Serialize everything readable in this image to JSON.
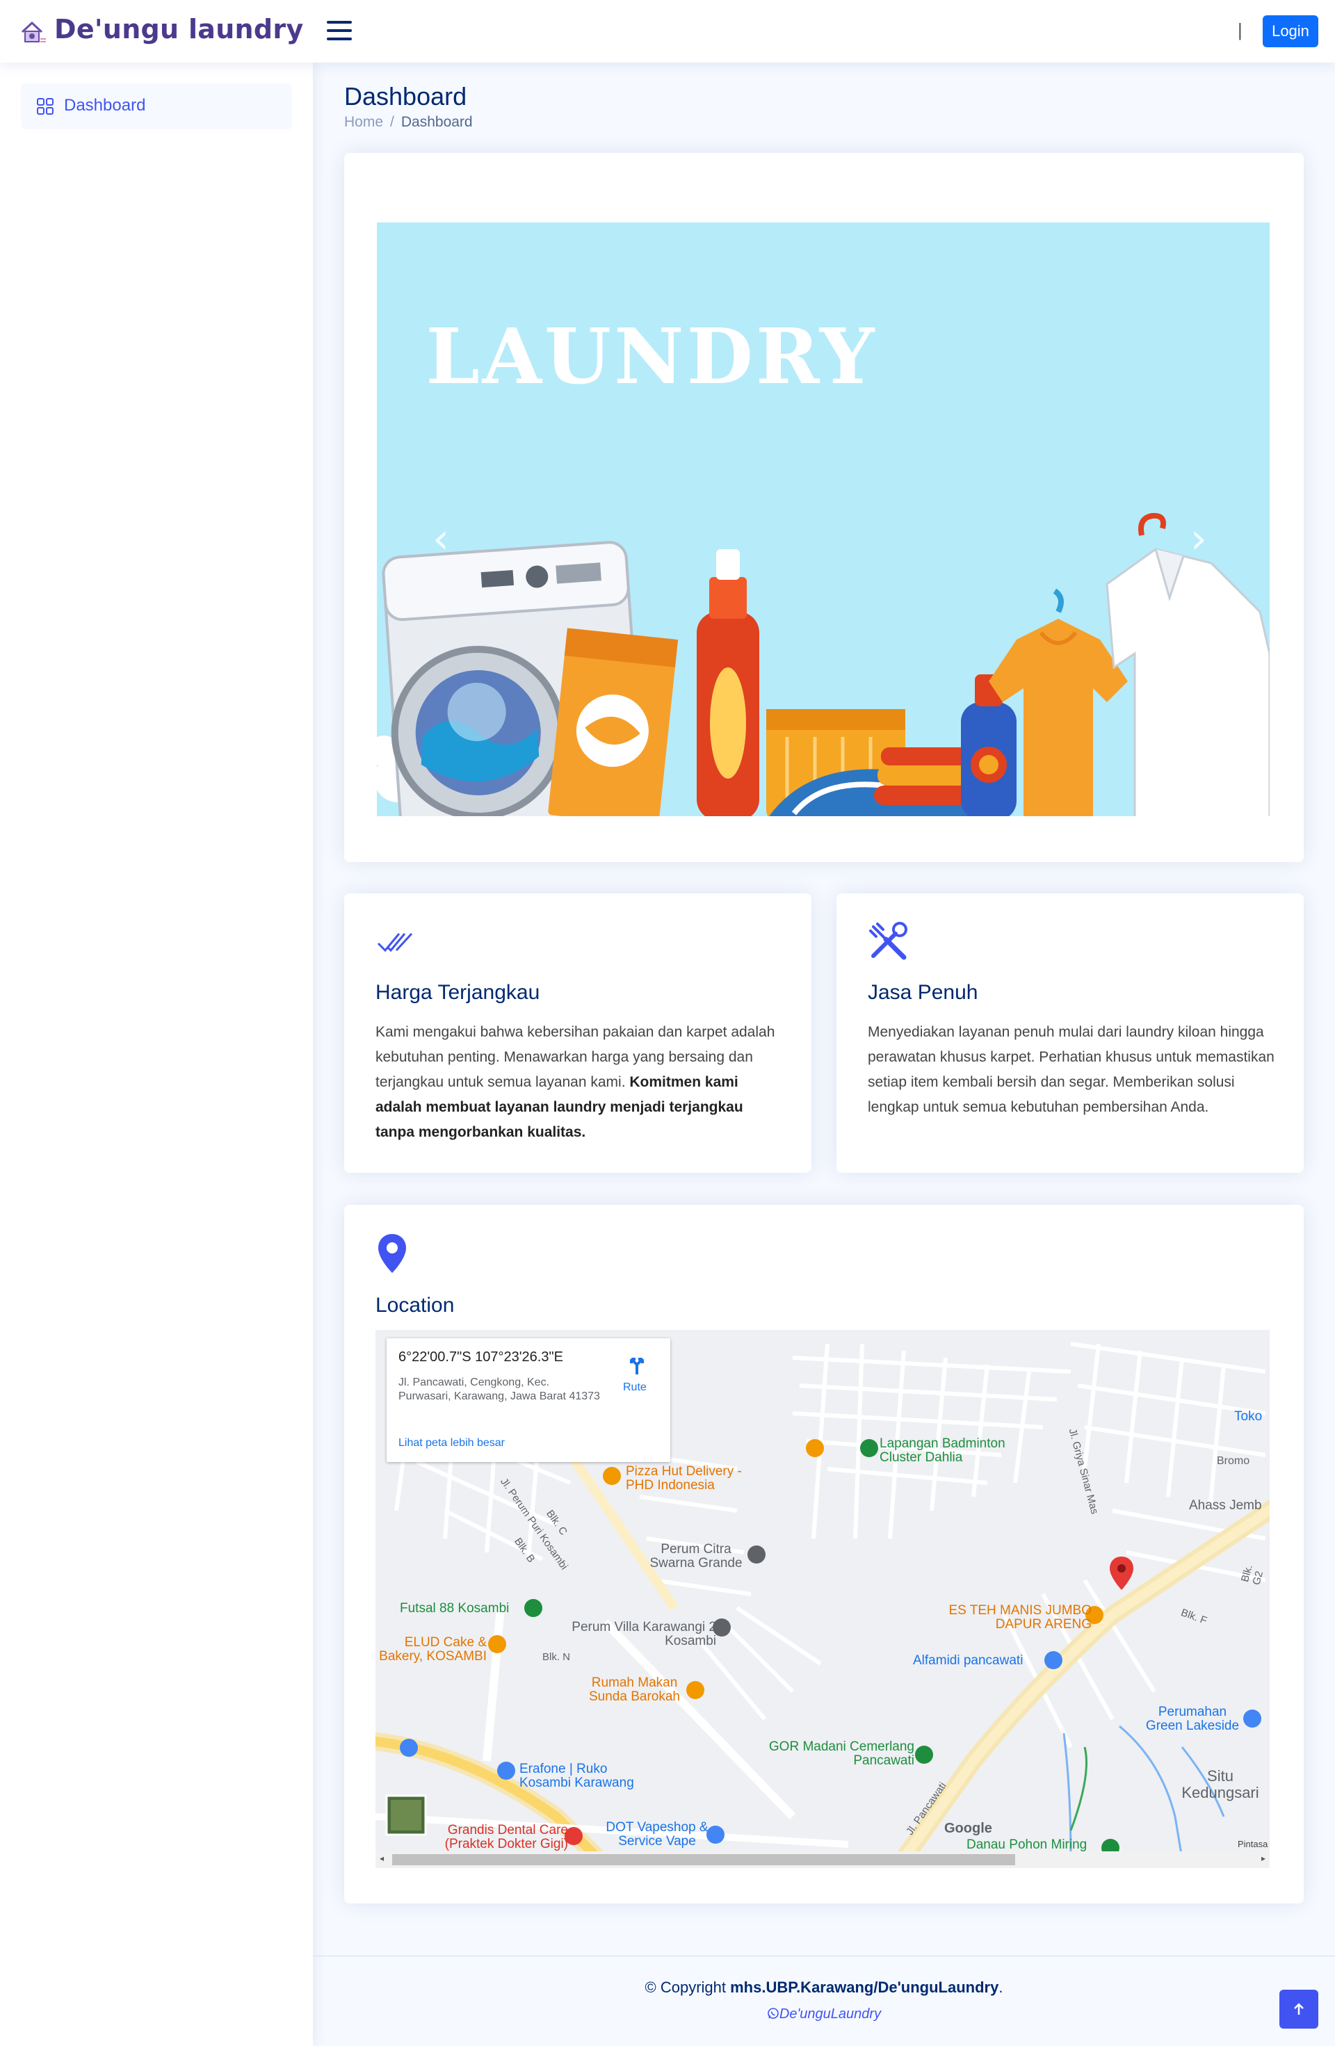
{
  "header": {
    "brand": "De'ungu laundry",
    "separator": "|",
    "login_label": "Login"
  },
  "sidebar": {
    "items": [
      {
        "label": "Dashboard",
        "icon": "grid-icon",
        "active": true
      }
    ]
  },
  "page": {
    "title": "Dashboard",
    "breadcrumb": [
      "Home",
      "Dashboard"
    ]
  },
  "banner": {
    "heading": "LAUNDRY",
    "prev_icon": "chevron-left-icon",
    "next_icon": "chevron-right-icon"
  },
  "features": [
    {
      "icon": "check-all-icon",
      "title": "Harga Terjangkau",
      "text": "Kami mengakui bahwa kebersihan pakaian dan karpet adalah kebutuhan penting. Menawarkan harga yang bersaing dan terjangkau untuk semua layanan kami.",
      "bold_text": "Komitmen kami adalah membuat layanan laundry menjadi terjangkau tanpa mengorbankan kualitas."
    },
    {
      "icon": "tools-icon",
      "title": "Jasa Penuh",
      "text": "Menyediakan layanan penuh mulai dari laundry kiloan hingga perawatan khusus karpet. Perhatian khusus untuk memastikan setiap item kembali bersih dan segar. Memberikan solusi lengkap untuk semua kebutuhan pembersihan Anda.",
      "bold_text": ""
    }
  ],
  "location": {
    "icon": "geo-pin-icon",
    "title": "Location",
    "map": {
      "coords": "6°22'00.7\"S 107°23'26.3\"E",
      "address": "Jl. Pancawati, Cengkong, Kec. Purwasari, Karawang, Jawa Barat 41373",
      "route_label": "Rute",
      "larger_map_link": "Lihat peta lebih besar",
      "places": [
        "Lapangan Badminton Cluster Dahlia",
        "Pizza Hut Delivery - PHD Indonesia",
        "Perum Citra Swarna Grande",
        "Futsal 88 Kosambi",
        "ES TEH MANIS JUMBO DAPUR ARENG",
        "Perum Villa Karawangi 2 Kosambi",
        "ELUD Cake & Bakery, KOSAMBI",
        "Alfamidi pancawati",
        "Rumah Makan Sunda Barokah",
        "Perumahan Green Lakeside",
        "GOR Madani Cemerlang Pancawati",
        "Erafone | Ruko Kosambi Karawang",
        "Situ Kedungsari",
        "Grandis Dental Care (Praktek Dokter Gigi)",
        "DOT Vapeshop & Service Vape",
        "Danau Pohon Miring",
        "Ahass Jemb",
        "Toko",
        "Bromo"
      ],
      "streets": [
        "Jl. Griya Sinar Mas",
        "Jl. Perum Puri Kosambi",
        "Blk. N",
        "Blk. B",
        "Blk. C",
        "Blk. F",
        "Blk. G2",
        "Jl. Pancawati"
      ],
      "attribution": "Google",
      "data_label": "Pintasa"
    }
  },
  "footer": {
    "copyright_prefix": "© Copyright ",
    "copyright_owner": "mhs.UBP.Karawang/De'unguLaundry",
    "copyright_suffix": ".",
    "whatsapp": "De'unguLaundry"
  }
}
